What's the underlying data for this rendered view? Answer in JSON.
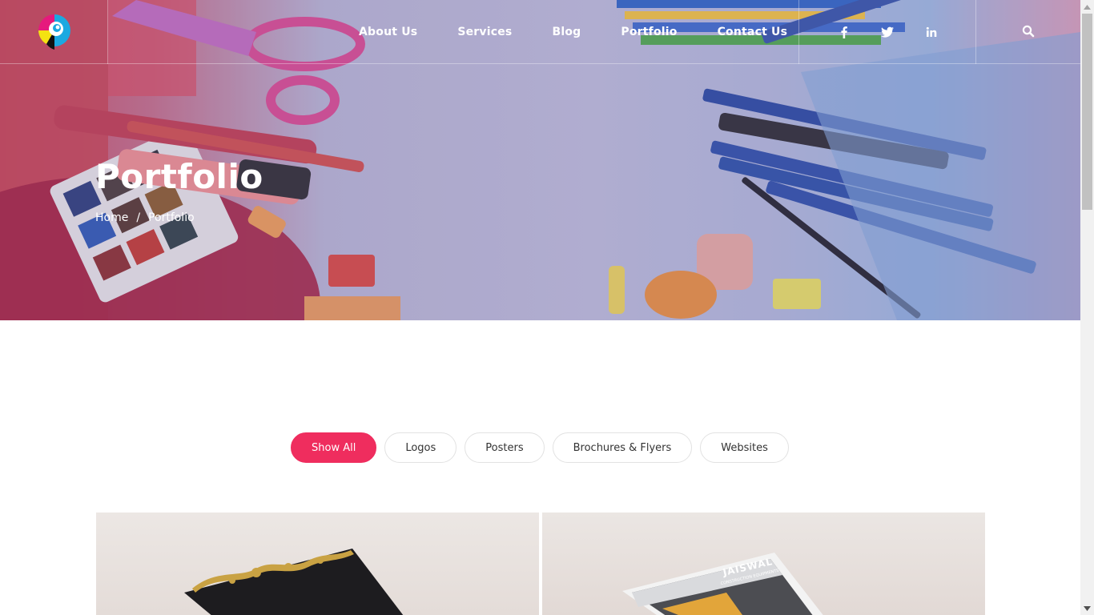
{
  "nav": {
    "items": [
      {
        "label": "About Us"
      },
      {
        "label": "Services"
      },
      {
        "label": "Blog"
      },
      {
        "label": "Portfolio"
      },
      {
        "label": "Contact Us"
      }
    ]
  },
  "social": {
    "icons": [
      "facebook-icon",
      "twitter-icon",
      "linkedin-icon"
    ]
  },
  "hero": {
    "title": "Portfolio",
    "breadcrumb": {
      "home": "Home",
      "separator": "/",
      "current": "Portfolio"
    }
  },
  "filters": {
    "items": [
      {
        "label": "Show All",
        "active": true
      },
      {
        "label": "Logos",
        "active": false
      },
      {
        "label": "Posters",
        "active": false
      },
      {
        "label": "Brochures & Flyers",
        "active": false
      },
      {
        "label": "Websites",
        "active": false
      }
    ]
  },
  "portfolio": {
    "card2_brand": "JAISWAL",
    "card2_subtitle": "CONSTRUCTION EQUIPMENTS"
  },
  "colors": {
    "accent": "#ef2d5e",
    "nav_text": "#ffffff",
    "filter_border": "#e2e2e2"
  }
}
